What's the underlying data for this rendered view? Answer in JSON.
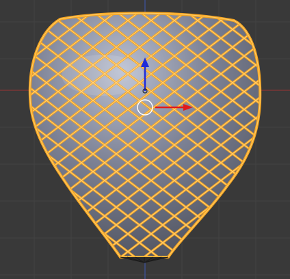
{
  "viewport": {
    "background": "#393939",
    "grid_color": "#424242",
    "axis_x_color": "#7a3535",
    "axis_z_color": "#3d4f8e"
  },
  "mesh": {
    "object": "wireframe-vase",
    "selected": true,
    "edge_color": "#f5a623",
    "edge_highlight": "#ffcf6e",
    "face_color": "#6f7486",
    "face_highlight": "#b9bfd0"
  },
  "gizmo": {
    "x_arrow_color": "#e21b1b",
    "z_arrow_color": "#1f2bd9",
    "cursor_ring_color": "#ffffff"
  }
}
